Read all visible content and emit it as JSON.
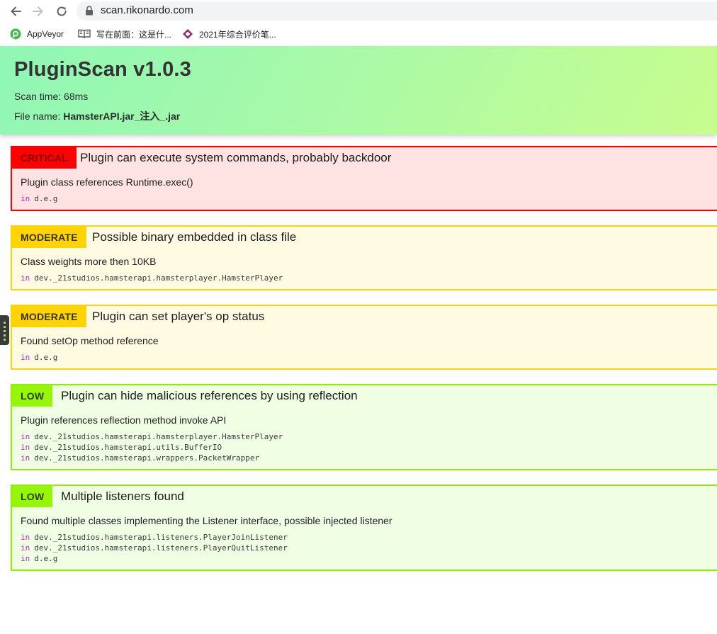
{
  "browser": {
    "url": "scan.rikonardo.com",
    "bookmarks": [
      {
        "label": "AppVeyor",
        "icon": "appveyor-icon"
      },
      {
        "label": "写在前面：这是什...",
        "icon": "book-icon"
      },
      {
        "label": "2021年综合评价笔...",
        "icon": "diamond-icon"
      }
    ]
  },
  "header": {
    "title": "PluginScan v1.0.3",
    "scan_time_label": "Scan time: ",
    "scan_time": "68ms",
    "file_name_label": "File name: ",
    "file_name": "HamsterAPI.jar_注入_.jar",
    "gradient": [
      "#8ff7b5",
      "#c8fd8e"
    ]
  },
  "severity_colors": {
    "critical": "#ff0000",
    "moderate": "#ffd400",
    "low": "#95f60a"
  },
  "findings": [
    {
      "severity": "CRITICAL",
      "title": "Plugin can execute system commands, probably backdoor",
      "description": "Plugin class references Runtime.exec()",
      "locations": [
        {
          "kw": "in",
          "path": "d.e.g"
        }
      ]
    },
    {
      "severity": "MODERATE",
      "title": "Possible binary embedded in class file",
      "description": "Class weights more then 10KB",
      "locations": [
        {
          "kw": "in",
          "path": "dev._21studios.hamsterapi.hamsterplayer.HamsterPlayer"
        }
      ]
    },
    {
      "severity": "MODERATE",
      "title": "Plugin can set player's op status",
      "description": "Found setOp method reference",
      "locations": [
        {
          "kw": "in",
          "path": "d.e.g"
        }
      ]
    },
    {
      "severity": "LOW",
      "title": "Plugin can hide malicious references by using reflection",
      "description": "Plugin references reflection method invoke API",
      "locations": [
        {
          "kw": "in",
          "path": "dev._21studios.hamsterapi.hamsterplayer.HamsterPlayer"
        },
        {
          "kw": "in",
          "path": "dev._21studios.hamsterapi.utils.BufferIO"
        },
        {
          "kw": "in",
          "path": "dev._21studios.hamsterapi.wrappers.PacketWrapper"
        }
      ]
    },
    {
      "severity": "LOW",
      "title": "Multiple listeners found",
      "description": "Found multiple classes implementing the Listener interface, possible injected listener",
      "locations": [
        {
          "kw": "in",
          "path": "dev._21studios.hamsterapi.listeners.PlayerJoinListener"
        },
        {
          "kw": "in",
          "path": "dev._21studios.hamsterapi.listeners.PlayerQuitListener"
        },
        {
          "kw": "in",
          "path": "d.e.g"
        }
      ]
    }
  ]
}
